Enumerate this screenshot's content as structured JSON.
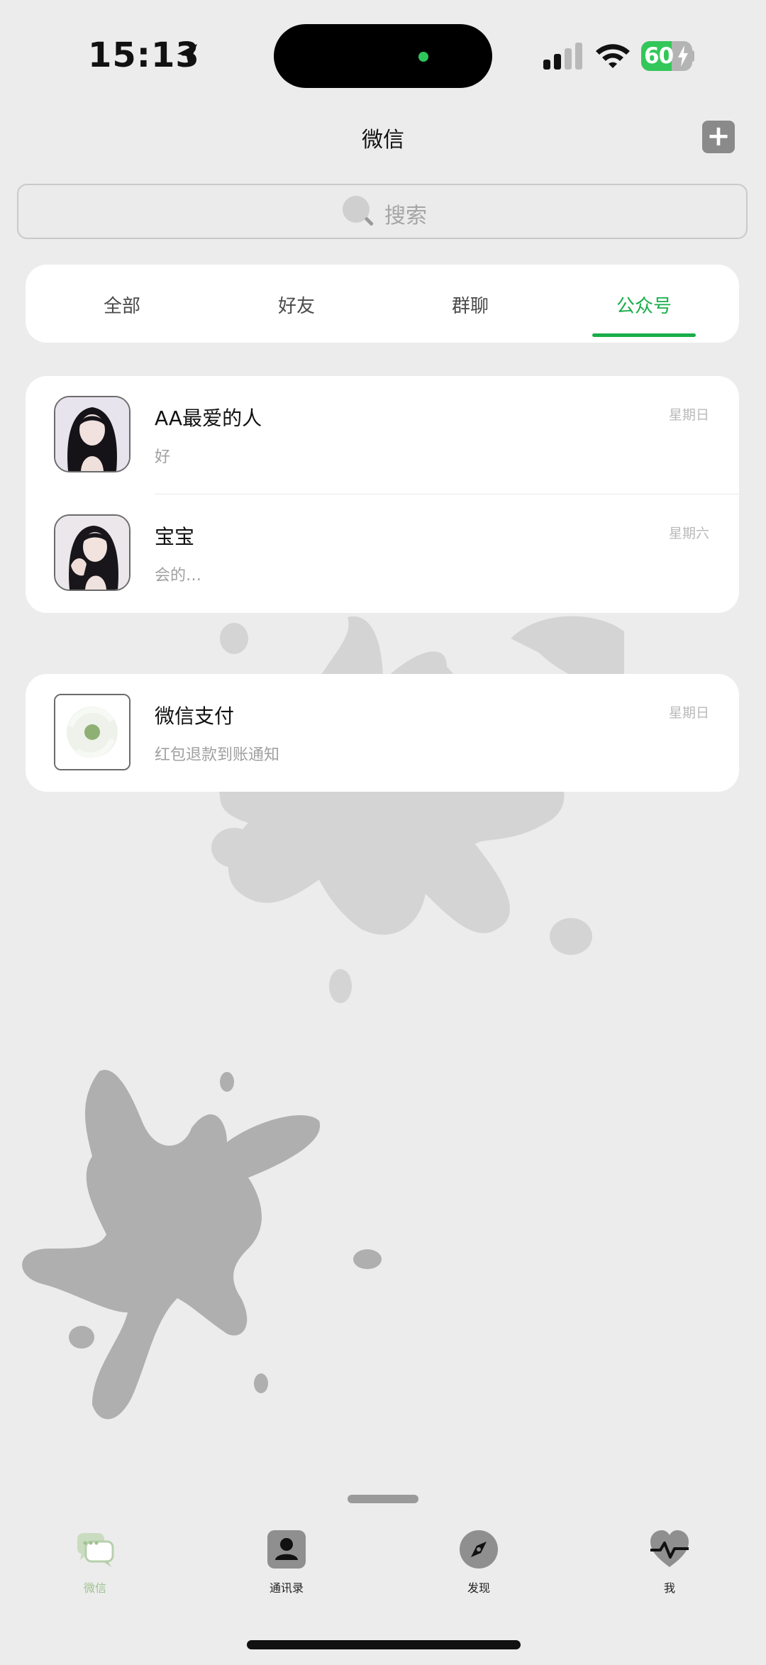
{
  "status_bar": {
    "time": "15:13",
    "battery_percent": "60",
    "battery_level": 0.6
  },
  "header": {
    "title": "微信",
    "add_icon": "plus-icon"
  },
  "search": {
    "placeholder": "搜索",
    "icon": "search-icon"
  },
  "tabs": [
    {
      "label": "全部",
      "active": false
    },
    {
      "label": "好友",
      "active": false
    },
    {
      "label": "群聊",
      "active": false
    },
    {
      "label": "公众号",
      "active": true
    }
  ],
  "chats": [
    {
      "name": "AA最爱的人",
      "preview": "好",
      "time": "星期日"
    },
    {
      "name": "宝宝",
      "preview": "会的…",
      "time": "星期六"
    }
  ],
  "service_chat": {
    "name": "微信支付",
    "preview": "红包退款到账通知",
    "time": "星期日"
  },
  "bottom_nav": [
    {
      "label": "微信",
      "icon": "chat-bubbles-icon",
      "active": true
    },
    {
      "label": "通讯录",
      "icon": "contacts-icon",
      "active": false
    },
    {
      "label": "发现",
      "icon": "compass-icon",
      "active": false
    },
    {
      "label": "我",
      "icon": "heart-pulse-icon",
      "active": false
    }
  ],
  "colors": {
    "accent": "#1aad4a",
    "background": "#ececec",
    "nav_active": "#9fc38f"
  }
}
